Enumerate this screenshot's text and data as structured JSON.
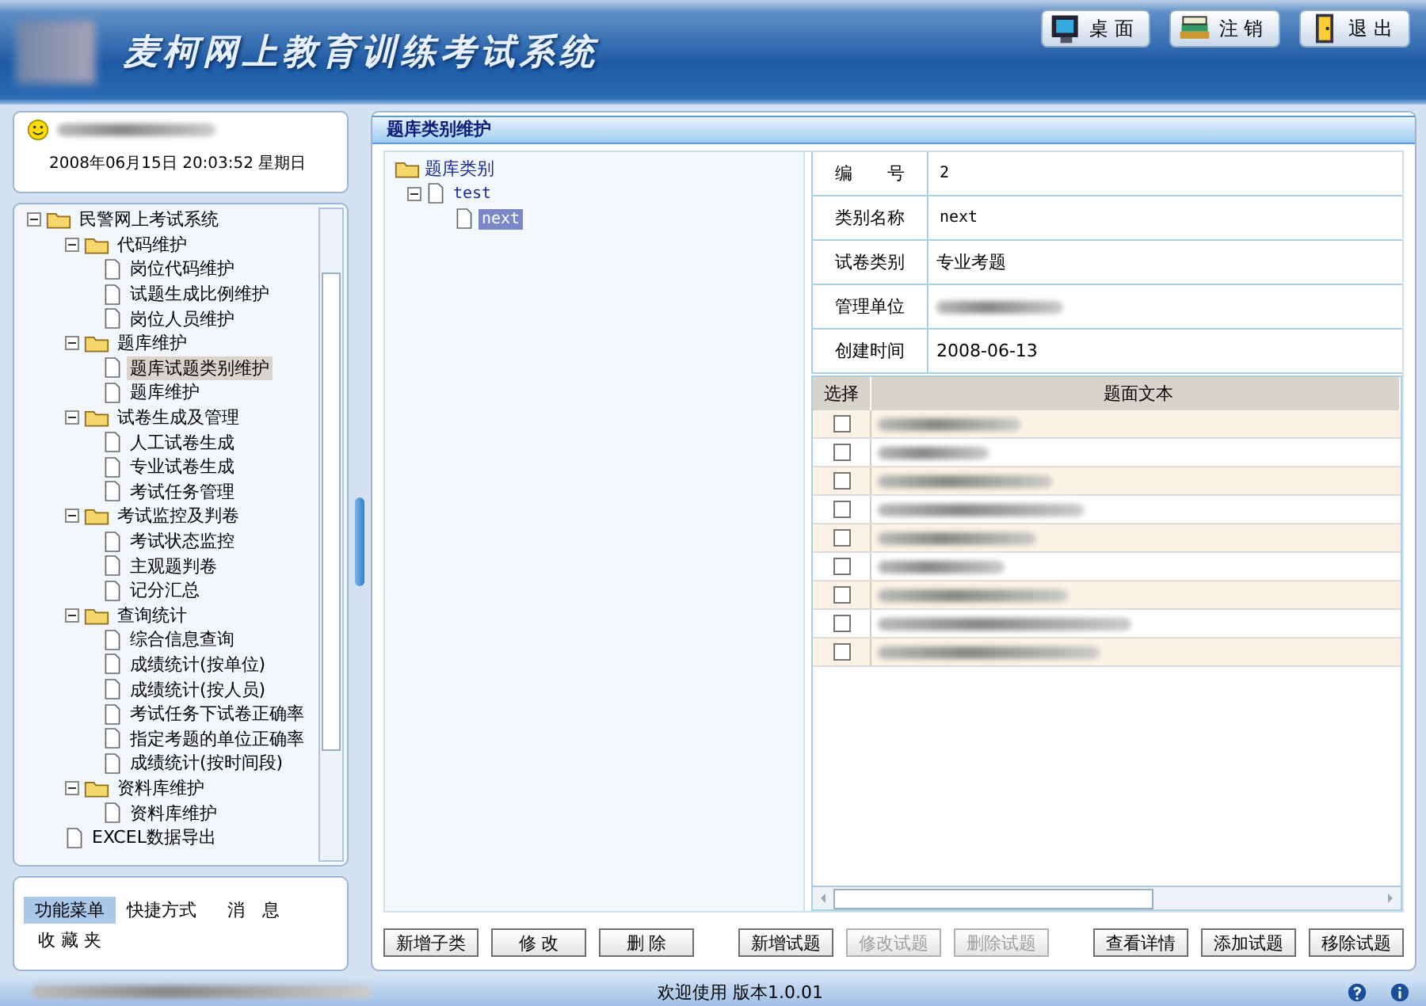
{
  "header": {
    "title": "麦柯网上教育训练考试系统",
    "buttons": [
      {
        "label": "桌 面",
        "kind": "desktop"
      },
      {
        "label": "注 销",
        "kind": "logout"
      },
      {
        "label": "退 出",
        "kind": "exit"
      }
    ]
  },
  "user_panel": {
    "datetime": "2008年06月15日 20:03:52 星期日"
  },
  "menu_tree": [
    {
      "label": "民警网上考试系统",
      "expanded": true,
      "selected": false,
      "children": [
        {
          "label": "代码维护",
          "expanded": true,
          "selected": false,
          "children": [
            {
              "label": "岗位代码维护",
              "selected": false
            },
            {
              "label": "试题生成比例维护",
              "selected": false
            },
            {
              "label": "岗位人员维护",
              "selected": false
            }
          ]
        },
        {
          "label": "题库维护",
          "expanded": true,
          "selected": false,
          "children": [
            {
              "label": "题库试题类别维护",
              "selected": true
            },
            {
              "label": "题库维护",
              "selected": false
            }
          ]
        },
        {
          "label": "试卷生成及管理",
          "expanded": true,
          "selected": false,
          "children": [
            {
              "label": "人工试卷生成",
              "selected": false
            },
            {
              "label": "专业试卷生成",
              "selected": false
            },
            {
              "label": "考试任务管理",
              "selected": false
            }
          ]
        },
        {
          "label": "考试监控及判卷",
          "expanded": true,
          "selected": false,
          "children": [
            {
              "label": "考试状态监控",
              "selected": false
            },
            {
              "label": "主观题判卷",
              "selected": false
            },
            {
              "label": "记分汇总",
              "selected": false
            }
          ]
        },
        {
          "label": "查询统计",
          "expanded": true,
          "selected": false,
          "children": [
            {
              "label": "综合信息查询",
              "selected": false
            },
            {
              "label": "成绩统计(按单位)",
              "selected": false
            },
            {
              "label": "成绩统计(按人员)",
              "selected": false
            },
            {
              "label": "考试任务下试卷正确率",
              "selected": false
            },
            {
              "label": "指定考题的单位正确率",
              "selected": false
            },
            {
              "label": "成绩统计(按时间段)",
              "selected": false
            }
          ]
        },
        {
          "label": "资料库维护",
          "expanded": true,
          "selected": false,
          "children": [
            {
              "label": "资料库维护",
              "selected": false
            }
          ]
        },
        {
          "label": "EXCEL数据导出",
          "selected": false
        }
      ]
    }
  ],
  "bottom_tabs": [
    {
      "label": "功能菜单",
      "selected": true
    },
    {
      "label": "快捷方式",
      "selected": false
    },
    {
      "label": "消　息",
      "selected": false
    },
    {
      "label": "收 藏 夹",
      "selected": false
    }
  ],
  "main": {
    "title": "题库类别维护",
    "category_tree": {
      "label": "题库类别",
      "children": [
        {
          "label": "test",
          "selected": false,
          "children": [
            {
              "label": "next",
              "selected": true
            }
          ]
        }
      ]
    },
    "details": [
      {
        "label": "编　　号",
        "value": "2"
      },
      {
        "label": "类别名称",
        "value": "next"
      },
      {
        "label": "试卷类别",
        "value": "专业考题"
      },
      {
        "label": "管理单位"
      },
      {
        "label": "创建时间",
        "value": "2008-06-13"
      }
    ],
    "question_table": {
      "columns": [
        "选择",
        "题面文本"
      ],
      "rows": [
        {
          "checked": false
        },
        {
          "checked": false
        },
        {
          "checked": false
        },
        {
          "checked": false
        },
        {
          "checked": false
        },
        {
          "checked": false
        },
        {
          "checked": false
        },
        {
          "checked": false
        },
        {
          "checked": false
        }
      ]
    },
    "left_buttons": [
      {
        "label": "新增子类",
        "disabled": false
      },
      {
        "label": "修 改",
        "disabled": false
      },
      {
        "label": "删 除",
        "disabled": false
      }
    ],
    "middle_buttons": [
      {
        "label": "新增试题",
        "disabled": false
      },
      {
        "label": "修改试题",
        "disabled": true
      },
      {
        "label": "删除试题",
        "disabled": true
      }
    ],
    "right_buttons": [
      {
        "label": "查看详情",
        "disabled": false
      },
      {
        "label": "添加试题",
        "disabled": false
      },
      {
        "label": "移除试题",
        "disabled": false
      }
    ]
  },
  "status_bar": {
    "text": "欢迎使用 版本1.0.01"
  }
}
